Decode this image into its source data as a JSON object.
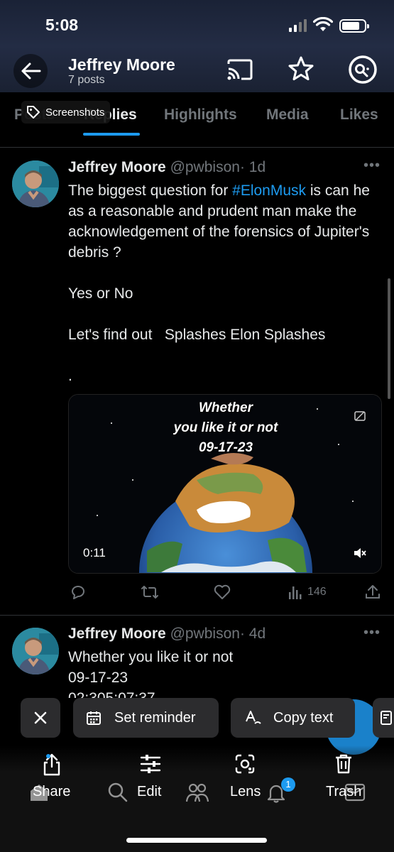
{
  "status_bar": {
    "time": "5:08"
  },
  "header": {
    "name": "Jeffrey Moore",
    "posts": "7 posts"
  },
  "tabs": [
    {
      "label": "Posts"
    },
    {
      "label": "Replies",
      "active": true
    },
    {
      "label": "Highlights"
    },
    {
      "label": "Media"
    },
    {
      "label": "Likes"
    }
  ],
  "screenshots_chip": {
    "label": "Screenshots"
  },
  "tweet1": {
    "name": "Jeffrey Moore",
    "handle": "@pwbison",
    "time": "· 1d",
    "text_before": "The biggest question for ",
    "hashtag": "#ElonMusk",
    "text_after": " is can he as a reasonable and prudent man make the acknowledgement of the forensics of Jupiter's debris ?\n\nYes or No\n\nLet's find out   Splashes Elon Splashes\n\n.",
    "media": {
      "line1": "Whether",
      "line2": "you like it or not",
      "line3": "09-17-23",
      "duration": "0:11"
    },
    "views": "146"
  },
  "tweet2": {
    "name": "Jeffrey Moore",
    "handle": "@pwbison",
    "time": "· 4d",
    "line1": "Whether you like it or not",
    "line2": "09-17-23",
    "line3": "02:305:07:37"
  },
  "overlay": {
    "set_reminder": "Set reminder",
    "copy_text": "Copy text"
  },
  "bottom": {
    "share": "Share",
    "edit": "Edit",
    "lens": "Lens",
    "trash": "Trash",
    "notif_badge": "1"
  }
}
